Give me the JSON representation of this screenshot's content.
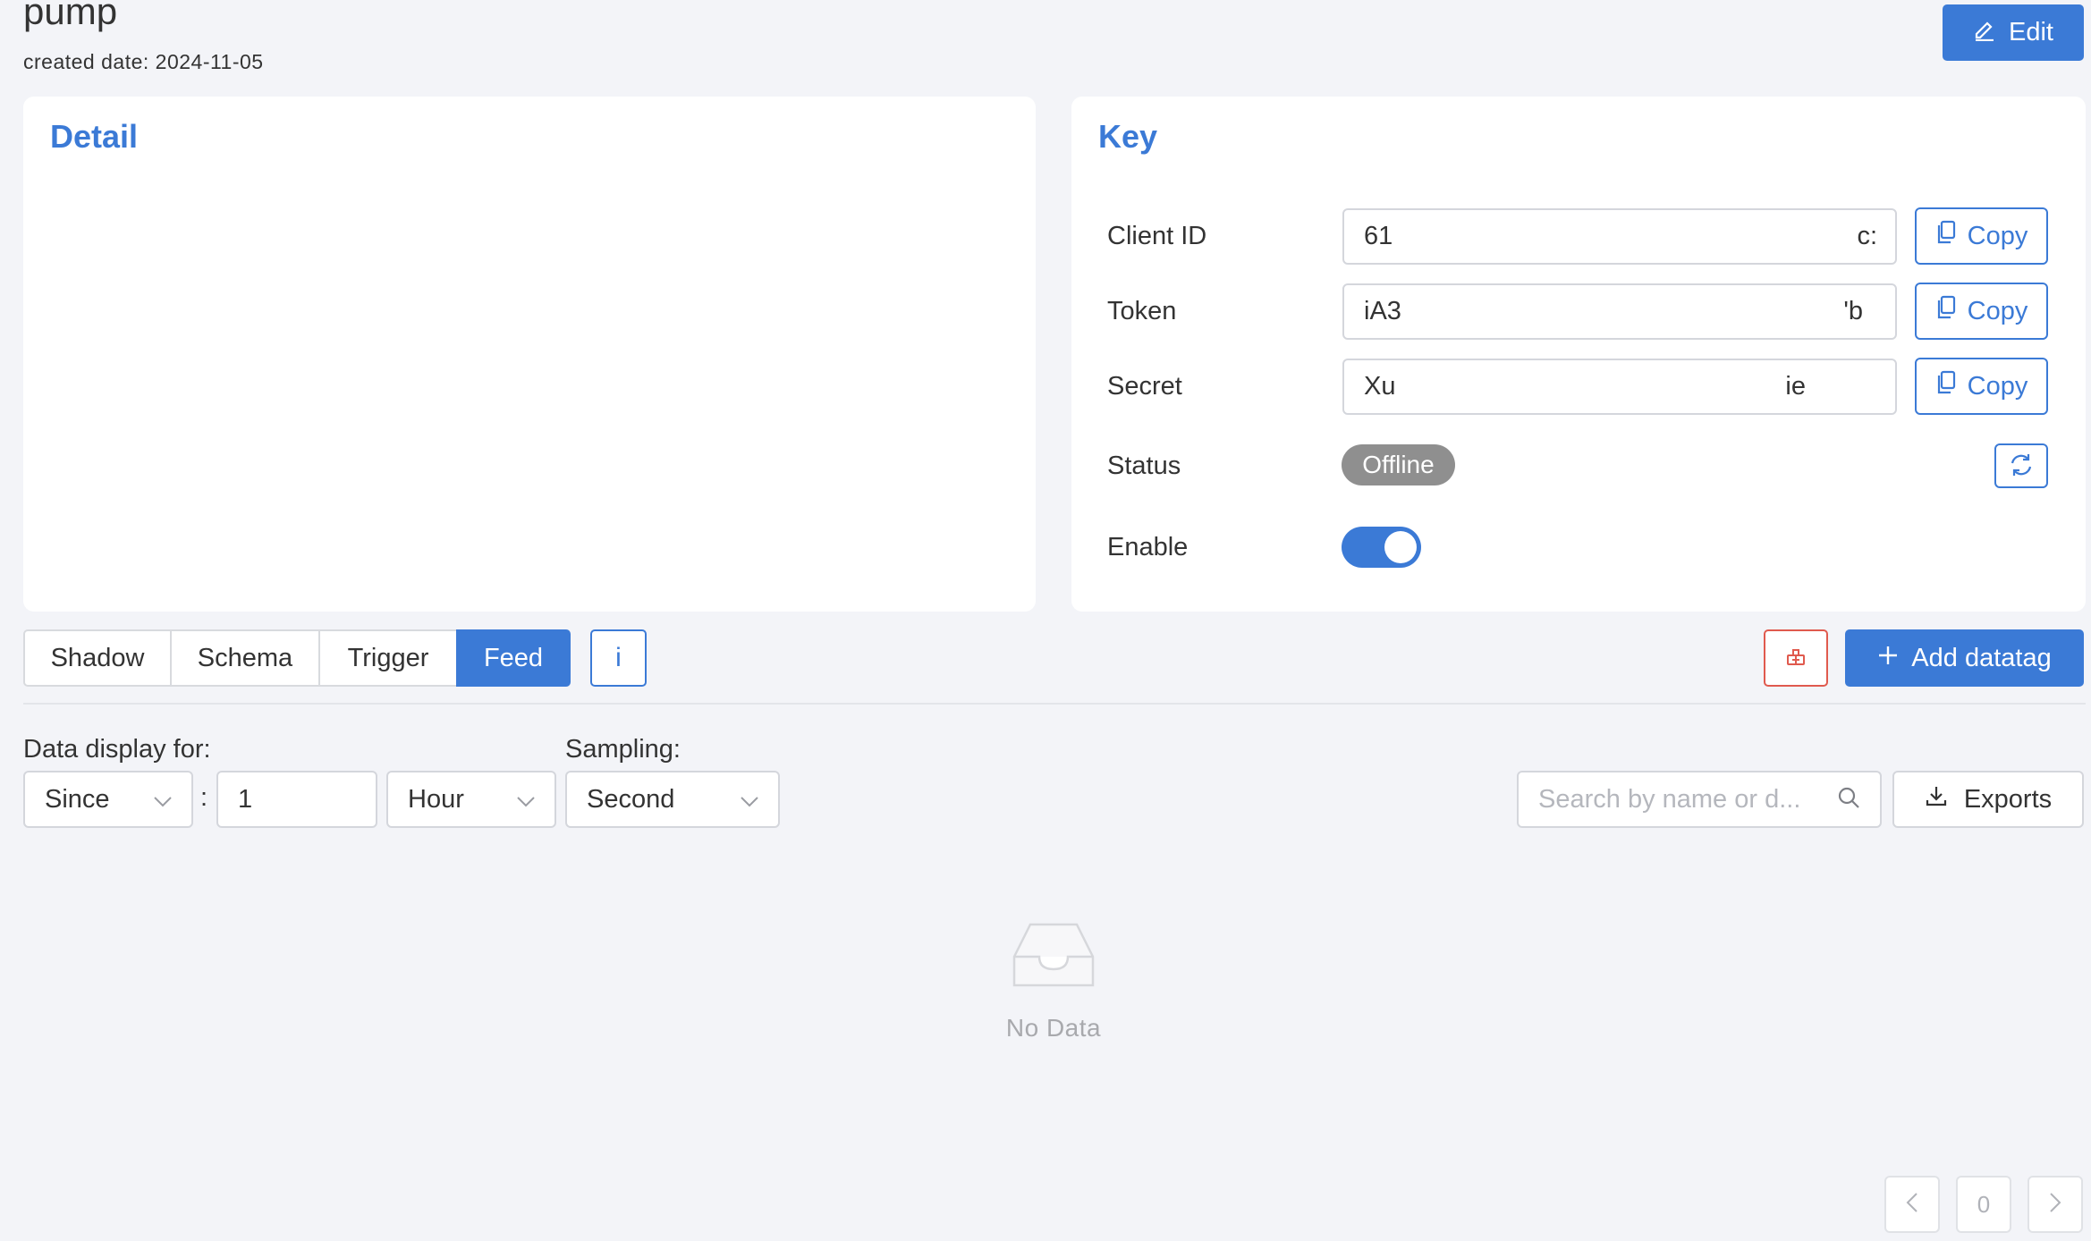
{
  "header": {
    "title": "pump",
    "created": "created date: 2024-11-05",
    "edit_label": "Edit"
  },
  "detail": {
    "title": "Detail"
  },
  "key": {
    "title": "Key",
    "rows": [
      {
        "label": "Client ID",
        "value_start": "61",
        "value_end": "c:",
        "copy_label": "Copy"
      },
      {
        "label": "Token",
        "value_start": "iA3",
        "value_end": "'b",
        "copy_label": "Copy"
      },
      {
        "label": "Secret",
        "value_start": "Xu",
        "value_end": "ie",
        "copy_label": "Copy"
      }
    ],
    "status_label": "Status",
    "status_value": "Offline",
    "enable_label": "Enable",
    "enabled": true
  },
  "tabs": [
    {
      "label": "Shadow",
      "active": false
    },
    {
      "label": "Schema",
      "active": false
    },
    {
      "label": "Trigger",
      "active": false
    },
    {
      "label": "Feed",
      "active": true
    }
  ],
  "info_label": "i",
  "add_datatag_label": "Add datatag",
  "filters": {
    "display_label": "Data display for:",
    "since_value": "Since",
    "colon": ":",
    "amount_value": "1",
    "unit_value": "Hour",
    "sampling_label": "Sampling:",
    "sampling_value": "Second",
    "search_placeholder": "Search by name or d...",
    "export_label": "Exports"
  },
  "empty": {
    "text": "No Data"
  },
  "pagination": {
    "page": "0"
  },
  "colors": {
    "accent": "#3b7ad6",
    "danger": "#e05a4e",
    "background": "#f3f4f8",
    "badge_offline": "#8f8f8f"
  }
}
